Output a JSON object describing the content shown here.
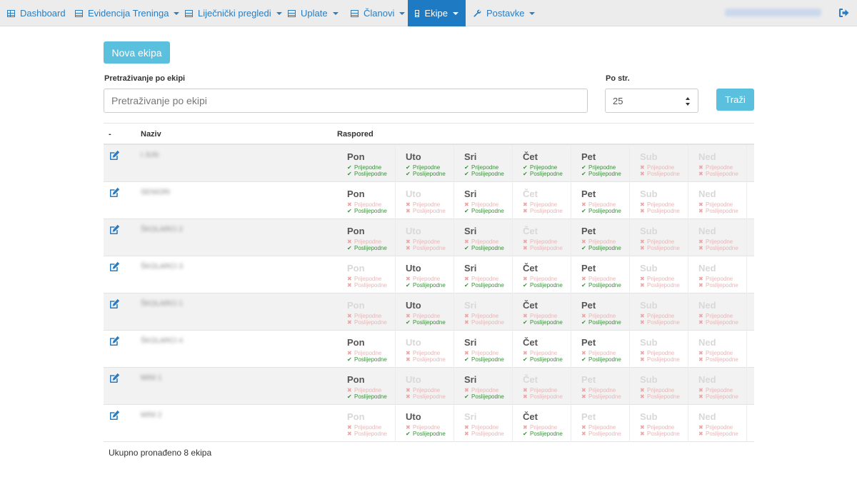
{
  "nav": {
    "items": [
      {
        "label": "Dashboard",
        "icon": "table-icon",
        "caret": false,
        "active": false
      },
      {
        "label": "Evidencija Treninga",
        "icon": "list-icon",
        "caret": true,
        "active": false
      },
      {
        "label": "Liječnički pregledi",
        "icon": "list-icon",
        "caret": true,
        "active": false
      },
      {
        "label": "Uplate",
        "icon": "list-icon",
        "caret": true,
        "active": false
      },
      {
        "label": "Članovi",
        "icon": "list-icon",
        "caret": true,
        "active": false
      },
      {
        "label": "Ekipe",
        "icon": "list-icon",
        "caret": true,
        "active": true
      },
      {
        "label": "Postavke",
        "icon": "wrench-icon",
        "caret": true,
        "active": false
      }
    ]
  },
  "toolbar": {
    "new_team_label": "Nova ekipa",
    "search_label": "Pretraživanje po ekipi",
    "search_placeholder": "Pretraživanje po ekipi",
    "per_page_label": "Po str.",
    "per_page_value": "25",
    "search_button": "Traži"
  },
  "table": {
    "headers": {
      "dash": "-",
      "name": "Naziv",
      "schedule": "Raspored"
    },
    "days": [
      "Pon",
      "Uto",
      "Sri",
      "Čet",
      "Pet",
      "Sub",
      "Ned"
    ],
    "slot_labels": {
      "morning": "Prijepodne",
      "afternoon": "Poslijepodne"
    },
    "rows": [
      {
        "name": "I JUN",
        "schedule": [
          [
            1,
            1
          ],
          [
            1,
            1
          ],
          [
            1,
            1
          ],
          [
            1,
            1
          ],
          [
            1,
            1
          ],
          [
            0,
            0
          ],
          [
            0,
            0
          ]
        ]
      },
      {
        "name": "SENIORI",
        "schedule": [
          [
            0,
            1
          ],
          [
            0,
            0
          ],
          [
            0,
            1
          ],
          [
            0,
            0
          ],
          [
            0,
            1
          ],
          [
            0,
            0
          ],
          [
            0,
            0
          ]
        ]
      },
      {
        "name": "ŠKOLARCI 2",
        "schedule": [
          [
            0,
            1
          ],
          [
            0,
            0
          ],
          [
            0,
            1
          ],
          [
            0,
            0
          ],
          [
            0,
            1
          ],
          [
            0,
            0
          ],
          [
            0,
            0
          ]
        ]
      },
      {
        "name": "ŠKOLARCI 3",
        "schedule": [
          [
            0,
            0
          ],
          [
            0,
            1
          ],
          [
            0,
            1
          ],
          [
            0,
            1
          ],
          [
            0,
            1
          ],
          [
            0,
            0
          ],
          [
            0,
            0
          ]
        ]
      },
      {
        "name": "ŠKOLARCI 1",
        "schedule": [
          [
            0,
            0
          ],
          [
            0,
            1
          ],
          [
            0,
            0
          ],
          [
            0,
            1
          ],
          [
            0,
            1
          ],
          [
            0,
            0
          ],
          [
            0,
            0
          ]
        ]
      },
      {
        "name": "ŠKOLARCI 4",
        "schedule": [
          [
            0,
            1
          ],
          [
            0,
            0
          ],
          [
            0,
            1
          ],
          [
            0,
            1
          ],
          [
            0,
            1
          ],
          [
            0,
            0
          ],
          [
            0,
            0
          ]
        ]
      },
      {
        "name": "MINI 1",
        "schedule": [
          [
            0,
            1
          ],
          [
            0,
            0
          ],
          [
            0,
            1
          ],
          [
            0,
            0
          ],
          [
            0,
            0
          ],
          [
            0,
            0
          ],
          [
            0,
            0
          ]
        ]
      },
      {
        "name": "MINI 2",
        "schedule": [
          [
            0,
            0
          ],
          [
            0,
            1
          ],
          [
            0,
            0
          ],
          [
            0,
            1
          ],
          [
            0,
            0
          ],
          [
            0,
            0
          ],
          [
            0,
            0
          ]
        ]
      }
    ]
  },
  "footer": {
    "total_text": "Ukupno pronađeno 8 ekipa"
  },
  "colors": {
    "accent": "#1e7ac2",
    "button": "#5bc0de",
    "check": "#2f9a2f",
    "cross": "#e9a6a6"
  }
}
